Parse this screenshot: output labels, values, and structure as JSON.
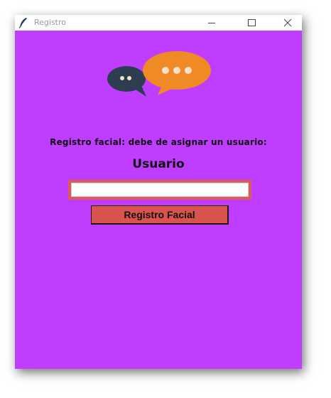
{
  "window": {
    "title": "Registro",
    "background": "#bf3dff",
    "controls": [
      "minimize-icon",
      "maximize-icon",
      "close-icon"
    ]
  },
  "logo": {
    "icon": "chat-bubbles-icon",
    "colors": {
      "dark_bubble": "#2c3e50",
      "orange_bubble": "#f08a24",
      "dots": "#f3e2cc"
    }
  },
  "form": {
    "prompt": "Registro facial: debe de asignar un usuario:",
    "user_label": "Usuario",
    "user_input_value": "",
    "input_border_color": "#dc5a59",
    "submit_label": "Registro Facial",
    "submit_color": "#d9534f"
  }
}
